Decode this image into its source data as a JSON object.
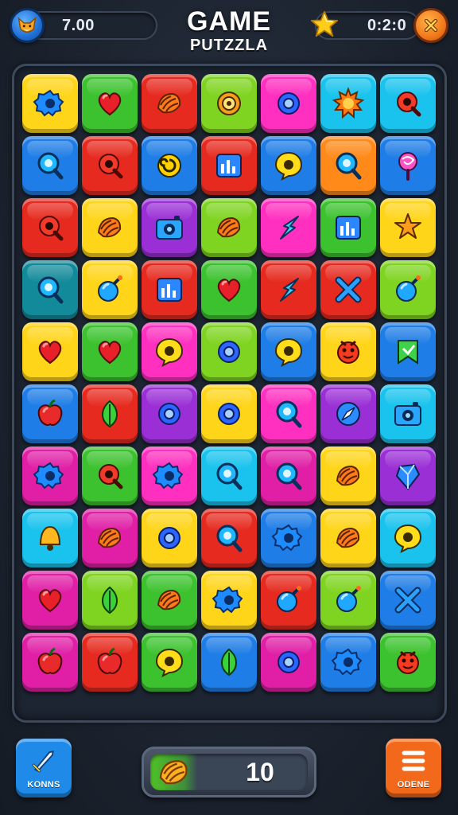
{
  "header": {
    "title": "GAME",
    "subtitle": "PUTZZLA",
    "score": "7.00",
    "timer": "0:2:0"
  },
  "board": {
    "rows": [
      [
        {
          "color": "yellow",
          "icon": "gear-icon"
        },
        {
          "color": "green",
          "icon": "heart-icon"
        },
        {
          "color": "red",
          "icon": "shell-icon"
        },
        {
          "color": "lime",
          "icon": "target-icon"
        },
        {
          "color": "pink",
          "icon": "ring-icon"
        },
        {
          "color": "cyan",
          "icon": "sun-icon"
        },
        {
          "color": "cyan",
          "icon": "q-icon"
        }
      ],
      [
        {
          "color": "blue",
          "icon": "magnifier-icon"
        },
        {
          "color": "red",
          "icon": "q-icon"
        },
        {
          "color": "blue",
          "icon": "spiral-icon"
        },
        {
          "color": "red",
          "icon": "chart-icon"
        },
        {
          "color": "blue",
          "icon": "bubble-icon"
        },
        {
          "color": "orange",
          "icon": "magnifier-icon"
        },
        {
          "color": "blue",
          "icon": "lollipop-icon"
        }
      ],
      [
        {
          "color": "red",
          "icon": "q-icon"
        },
        {
          "color": "yellow",
          "icon": "shell-icon"
        },
        {
          "color": "purple",
          "icon": "camera-icon"
        },
        {
          "color": "lime",
          "icon": "shell-icon"
        },
        {
          "color": "pink",
          "icon": "arrow-icon"
        },
        {
          "color": "green",
          "icon": "chart-icon"
        },
        {
          "color": "yellow",
          "icon": "star-icon"
        }
      ],
      [
        {
          "color": "teal",
          "icon": "magnifier-icon"
        },
        {
          "color": "yellow",
          "icon": "bomb-icon"
        },
        {
          "color": "red",
          "icon": "chart-icon"
        },
        {
          "color": "green",
          "icon": "heart-icon"
        },
        {
          "color": "red",
          "icon": "arrow-icon"
        },
        {
          "color": "red",
          "icon": "cross-icon"
        },
        {
          "color": "lime",
          "icon": "bomb-icon"
        }
      ],
      [
        {
          "color": "yellow",
          "icon": "heart-icon"
        },
        {
          "color": "green",
          "icon": "heart-icon"
        },
        {
          "color": "pink",
          "icon": "bubble-icon"
        },
        {
          "color": "lime",
          "icon": "ring-icon"
        },
        {
          "color": "blue",
          "icon": "bubble-icon"
        },
        {
          "color": "yellow",
          "icon": "face-icon"
        },
        {
          "color": "blue",
          "icon": "bookmark-icon"
        }
      ],
      [
        {
          "color": "blue",
          "icon": "apple-icon"
        },
        {
          "color": "red",
          "icon": "leaf-icon"
        },
        {
          "color": "purple",
          "icon": "ring-icon"
        },
        {
          "color": "yellow",
          "icon": "ring-icon"
        },
        {
          "color": "pink",
          "icon": "magnifier-icon"
        },
        {
          "color": "purple",
          "icon": "compass-icon"
        },
        {
          "color": "cyan",
          "icon": "camera-icon"
        }
      ],
      [
        {
          "color": "magenta",
          "icon": "gear-icon"
        },
        {
          "color": "green",
          "icon": "q-icon"
        },
        {
          "color": "pink",
          "icon": "gear-icon"
        },
        {
          "color": "cyan",
          "icon": "magnifier-icon"
        },
        {
          "color": "magenta",
          "icon": "magnifier-icon"
        },
        {
          "color": "yellow",
          "icon": "shell-icon"
        },
        {
          "color": "purple",
          "icon": "gem-icon"
        }
      ],
      [
        {
          "color": "cyan",
          "icon": "bell-icon"
        },
        {
          "color": "magenta",
          "icon": "shell-icon"
        },
        {
          "color": "yellow",
          "icon": "ring-icon"
        },
        {
          "color": "red",
          "icon": "magnifier-icon"
        },
        {
          "color": "blue",
          "icon": "gear-icon"
        },
        {
          "color": "yellow",
          "icon": "shell-icon"
        },
        {
          "color": "cyan",
          "icon": "bubble-icon"
        }
      ],
      [
        {
          "color": "magenta",
          "icon": "heart-icon"
        },
        {
          "color": "lime",
          "icon": "leaf-icon"
        },
        {
          "color": "green",
          "icon": "shell-icon"
        },
        {
          "color": "yellow",
          "icon": "gear-icon"
        },
        {
          "color": "red",
          "icon": "bomb-icon"
        },
        {
          "color": "lime",
          "icon": "bomb-icon"
        },
        {
          "color": "blue",
          "icon": "cross-icon"
        }
      ],
      [
        {
          "color": "magenta",
          "icon": "apple-icon"
        },
        {
          "color": "red",
          "icon": "apple-icon"
        },
        {
          "color": "green",
          "icon": "bubble-icon"
        },
        {
          "color": "blue",
          "icon": "leaf-icon"
        },
        {
          "color": "magenta",
          "icon": "ring-icon"
        },
        {
          "color": "blue",
          "icon": "gear-icon"
        },
        {
          "color": "green",
          "icon": "face-icon"
        }
      ]
    ]
  },
  "footer": {
    "left_button": "KONNS",
    "right_button": "ODENE",
    "counter_value": "10"
  }
}
